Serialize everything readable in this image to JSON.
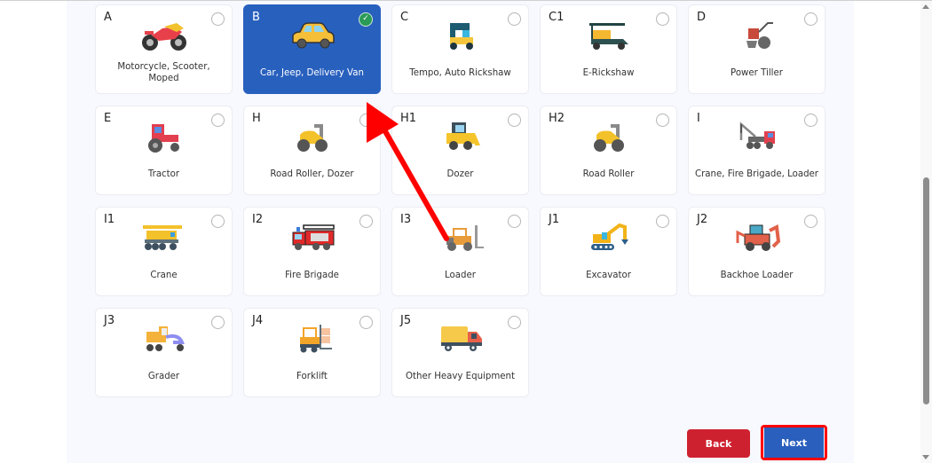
{
  "vehicle_classes": [
    {
      "code": "A",
      "label": "Motorcycle, Scooter, Moped",
      "icon": "motorcycle-icon",
      "selected": false
    },
    {
      "code": "B",
      "label": "Car, Jeep, Delivery Van",
      "icon": "car-icon",
      "selected": true
    },
    {
      "code": "C",
      "label": "Tempo, Auto Rickshaw",
      "icon": "auto-rickshaw-icon",
      "selected": false
    },
    {
      "code": "C1",
      "label": "E-Rickshaw",
      "icon": "e-rickshaw-icon",
      "selected": false
    },
    {
      "code": "D",
      "label": "Power Tiller",
      "icon": "power-tiller-icon",
      "selected": false
    },
    {
      "code": "E",
      "label": "Tractor",
      "icon": "tractor-icon",
      "selected": false
    },
    {
      "code": "H",
      "label": "Road Roller, Dozer",
      "icon": "road-roller-icon",
      "selected": false
    },
    {
      "code": "H1",
      "label": "Dozer",
      "icon": "dozer-icon",
      "selected": false
    },
    {
      "code": "H2",
      "label": "Road Roller",
      "icon": "road-roller-icon",
      "selected": false
    },
    {
      "code": "I",
      "label": "Crane, Fire Brigade, Loader",
      "icon": "tow-crane-truck-icon",
      "selected": false
    },
    {
      "code": "I1",
      "label": "Crane",
      "icon": "crane-truck-icon",
      "selected": false
    },
    {
      "code": "I2",
      "label": "Fire Brigade",
      "icon": "fire-truck-icon",
      "selected": false
    },
    {
      "code": "I3",
      "label": "Loader",
      "icon": "loader-icon",
      "selected": false
    },
    {
      "code": "J1",
      "label": "Excavator",
      "icon": "excavator-icon",
      "selected": false
    },
    {
      "code": "J2",
      "label": "Backhoe Loader",
      "icon": "backhoe-loader-icon",
      "selected": false
    },
    {
      "code": "J3",
      "label": "Grader",
      "icon": "grader-icon",
      "selected": false
    },
    {
      "code": "J4",
      "label": "Forklift",
      "icon": "forklift-icon",
      "selected": false
    },
    {
      "code": "J5",
      "label": "Other Heavy Equipment",
      "icon": "truck-icon",
      "selected": false
    }
  ],
  "buttons": {
    "back": "Back",
    "next": "Next"
  },
  "selected_check": "✓",
  "colors": {
    "selected_card": "#2860be",
    "check": "#2a9a57",
    "back": "#ce2130",
    "next": "#2a5fbd",
    "annotation": "#ff0000"
  }
}
